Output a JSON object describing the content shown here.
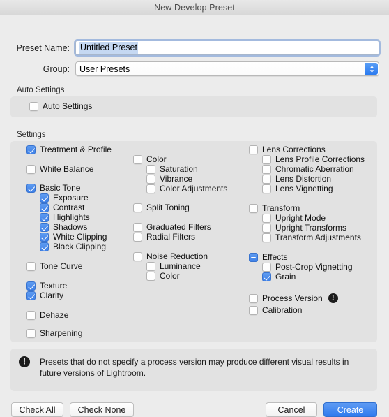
{
  "window": {
    "title": "New Develop Preset"
  },
  "form": {
    "preset_name_label": "Preset Name:",
    "preset_name_value": "Untitled Preset",
    "group_label": "Group:",
    "group_value": "User Presets"
  },
  "auto_settings": {
    "section_title": "Auto Settings",
    "checkbox_label": "Auto Settings",
    "checked": false
  },
  "settings": {
    "section_title": "Settings",
    "column_left": [
      {
        "label": "Treatment & Profile",
        "state": "on",
        "indent": 0
      },
      {
        "label": "White Balance",
        "state": "off",
        "indent": 0
      },
      {
        "label": "Basic Tone",
        "state": "on",
        "indent": 0
      },
      {
        "label": "Exposure",
        "state": "on",
        "indent": 1
      },
      {
        "label": "Contrast",
        "state": "on",
        "indent": 1
      },
      {
        "label": "Highlights",
        "state": "on",
        "indent": 1
      },
      {
        "label": "Shadows",
        "state": "on",
        "indent": 1
      },
      {
        "label": "White Clipping",
        "state": "on",
        "indent": 1
      },
      {
        "label": "Black Clipping",
        "state": "on",
        "indent": 1
      },
      {
        "label": "Tone Curve",
        "state": "off",
        "indent": 0
      },
      {
        "label": "Texture",
        "state": "on",
        "indent": 0
      },
      {
        "label": "Clarity",
        "state": "on",
        "indent": 0
      },
      {
        "label": "Dehaze",
        "state": "off",
        "indent": 0
      },
      {
        "label": "Sharpening",
        "state": "off",
        "indent": 0
      }
    ],
    "column_middle": [
      {
        "label": "Color",
        "state": "off",
        "indent": 0
      },
      {
        "label": "Saturation",
        "state": "off",
        "indent": 1
      },
      {
        "label": "Vibrance",
        "state": "off",
        "indent": 1
      },
      {
        "label": "Color Adjustments",
        "state": "off",
        "indent": 1
      },
      {
        "label": "Split Toning",
        "state": "off",
        "indent": 0
      },
      {
        "label": "Graduated Filters",
        "state": "off",
        "indent": 0
      },
      {
        "label": "Radial Filters",
        "state": "off",
        "indent": 0
      },
      {
        "label": "Noise Reduction",
        "state": "off",
        "indent": 0
      },
      {
        "label": "Luminance",
        "state": "off",
        "indent": 1
      },
      {
        "label": "Color",
        "state": "off",
        "indent": 1
      }
    ],
    "column_right": [
      {
        "label": "Lens Corrections",
        "state": "off",
        "indent": 0
      },
      {
        "label": "Lens Profile Corrections",
        "state": "off",
        "indent": 1
      },
      {
        "label": "Chromatic Aberration",
        "state": "off",
        "indent": 1
      },
      {
        "label": "Lens Distortion",
        "state": "off",
        "indent": 1
      },
      {
        "label": "Lens Vignetting",
        "state": "off",
        "indent": 1
      },
      {
        "label": "Transform",
        "state": "off",
        "indent": 0
      },
      {
        "label": "Upright Mode",
        "state": "off",
        "indent": 1
      },
      {
        "label": "Upright Transforms",
        "state": "off",
        "indent": 1
      },
      {
        "label": "Transform Adjustments",
        "state": "off",
        "indent": 1
      },
      {
        "label": "Effects",
        "state": "mixed",
        "indent": 0
      },
      {
        "label": "Post-Crop Vignetting",
        "state": "off",
        "indent": 1
      },
      {
        "label": "Grain",
        "state": "on",
        "indent": 1
      },
      {
        "label": "Process Version",
        "state": "off",
        "indent": 0,
        "warning": true
      },
      {
        "label": "Calibration",
        "state": "off",
        "indent": 0
      }
    ]
  },
  "notice": {
    "icon": "warning-icon",
    "text": "Presets that do not specify a process version may produce different visual results in future versions of Lightroom."
  },
  "buttons": {
    "check_all": "Check All",
    "check_none": "Check None",
    "cancel": "Cancel",
    "create": "Create"
  },
  "colors": {
    "accent": "#3f81e8",
    "primary_button": "#2f7aee",
    "window_bg": "#ececec",
    "panel_bg": "#e2e2e2",
    "selection": "#c5d8f2"
  }
}
